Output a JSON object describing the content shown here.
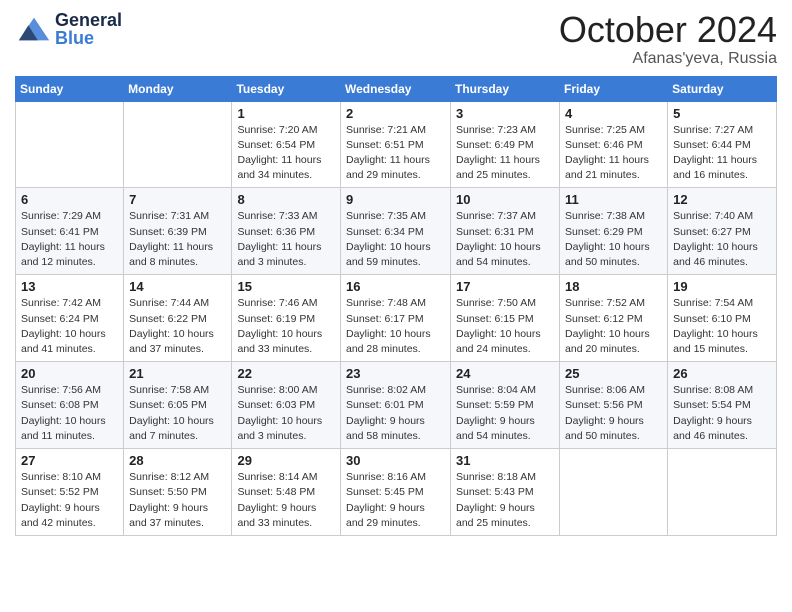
{
  "header": {
    "logo_general": "General",
    "logo_blue": "Blue",
    "month": "October 2024",
    "location": "Afanas'yeva, Russia"
  },
  "weekdays": [
    "Sunday",
    "Monday",
    "Tuesday",
    "Wednesday",
    "Thursday",
    "Friday",
    "Saturday"
  ],
  "weeks": [
    [
      {
        "day": "",
        "sunrise": "",
        "sunset": "",
        "daylight": ""
      },
      {
        "day": "",
        "sunrise": "",
        "sunset": "",
        "daylight": ""
      },
      {
        "day": "1",
        "sunrise": "Sunrise: 7:20 AM",
        "sunset": "Sunset: 6:54 PM",
        "daylight": "Daylight: 11 hours and 34 minutes."
      },
      {
        "day": "2",
        "sunrise": "Sunrise: 7:21 AM",
        "sunset": "Sunset: 6:51 PM",
        "daylight": "Daylight: 11 hours and 29 minutes."
      },
      {
        "day": "3",
        "sunrise": "Sunrise: 7:23 AM",
        "sunset": "Sunset: 6:49 PM",
        "daylight": "Daylight: 11 hours and 25 minutes."
      },
      {
        "day": "4",
        "sunrise": "Sunrise: 7:25 AM",
        "sunset": "Sunset: 6:46 PM",
        "daylight": "Daylight: 11 hours and 21 minutes."
      },
      {
        "day": "5",
        "sunrise": "Sunrise: 7:27 AM",
        "sunset": "Sunset: 6:44 PM",
        "daylight": "Daylight: 11 hours and 16 minutes."
      }
    ],
    [
      {
        "day": "6",
        "sunrise": "Sunrise: 7:29 AM",
        "sunset": "Sunset: 6:41 PM",
        "daylight": "Daylight: 11 hours and 12 minutes."
      },
      {
        "day": "7",
        "sunrise": "Sunrise: 7:31 AM",
        "sunset": "Sunset: 6:39 PM",
        "daylight": "Daylight: 11 hours and 8 minutes."
      },
      {
        "day": "8",
        "sunrise": "Sunrise: 7:33 AM",
        "sunset": "Sunset: 6:36 PM",
        "daylight": "Daylight: 11 hours and 3 minutes."
      },
      {
        "day": "9",
        "sunrise": "Sunrise: 7:35 AM",
        "sunset": "Sunset: 6:34 PM",
        "daylight": "Daylight: 10 hours and 59 minutes."
      },
      {
        "day": "10",
        "sunrise": "Sunrise: 7:37 AM",
        "sunset": "Sunset: 6:31 PM",
        "daylight": "Daylight: 10 hours and 54 minutes."
      },
      {
        "day": "11",
        "sunrise": "Sunrise: 7:38 AM",
        "sunset": "Sunset: 6:29 PM",
        "daylight": "Daylight: 10 hours and 50 minutes."
      },
      {
        "day": "12",
        "sunrise": "Sunrise: 7:40 AM",
        "sunset": "Sunset: 6:27 PM",
        "daylight": "Daylight: 10 hours and 46 minutes."
      }
    ],
    [
      {
        "day": "13",
        "sunrise": "Sunrise: 7:42 AM",
        "sunset": "Sunset: 6:24 PM",
        "daylight": "Daylight: 10 hours and 41 minutes."
      },
      {
        "day": "14",
        "sunrise": "Sunrise: 7:44 AM",
        "sunset": "Sunset: 6:22 PM",
        "daylight": "Daylight: 10 hours and 37 minutes."
      },
      {
        "day": "15",
        "sunrise": "Sunrise: 7:46 AM",
        "sunset": "Sunset: 6:19 PM",
        "daylight": "Daylight: 10 hours and 33 minutes."
      },
      {
        "day": "16",
        "sunrise": "Sunrise: 7:48 AM",
        "sunset": "Sunset: 6:17 PM",
        "daylight": "Daylight: 10 hours and 28 minutes."
      },
      {
        "day": "17",
        "sunrise": "Sunrise: 7:50 AM",
        "sunset": "Sunset: 6:15 PM",
        "daylight": "Daylight: 10 hours and 24 minutes."
      },
      {
        "day": "18",
        "sunrise": "Sunrise: 7:52 AM",
        "sunset": "Sunset: 6:12 PM",
        "daylight": "Daylight: 10 hours and 20 minutes."
      },
      {
        "day": "19",
        "sunrise": "Sunrise: 7:54 AM",
        "sunset": "Sunset: 6:10 PM",
        "daylight": "Daylight: 10 hours and 15 minutes."
      }
    ],
    [
      {
        "day": "20",
        "sunrise": "Sunrise: 7:56 AM",
        "sunset": "Sunset: 6:08 PM",
        "daylight": "Daylight: 10 hours and 11 minutes."
      },
      {
        "day": "21",
        "sunrise": "Sunrise: 7:58 AM",
        "sunset": "Sunset: 6:05 PM",
        "daylight": "Daylight: 10 hours and 7 minutes."
      },
      {
        "day": "22",
        "sunrise": "Sunrise: 8:00 AM",
        "sunset": "Sunset: 6:03 PM",
        "daylight": "Daylight: 10 hours and 3 minutes."
      },
      {
        "day": "23",
        "sunrise": "Sunrise: 8:02 AM",
        "sunset": "Sunset: 6:01 PM",
        "daylight": "Daylight: 9 hours and 58 minutes."
      },
      {
        "day": "24",
        "sunrise": "Sunrise: 8:04 AM",
        "sunset": "Sunset: 5:59 PM",
        "daylight": "Daylight: 9 hours and 54 minutes."
      },
      {
        "day": "25",
        "sunrise": "Sunrise: 8:06 AM",
        "sunset": "Sunset: 5:56 PM",
        "daylight": "Daylight: 9 hours and 50 minutes."
      },
      {
        "day": "26",
        "sunrise": "Sunrise: 8:08 AM",
        "sunset": "Sunset: 5:54 PM",
        "daylight": "Daylight: 9 hours and 46 minutes."
      }
    ],
    [
      {
        "day": "27",
        "sunrise": "Sunrise: 8:10 AM",
        "sunset": "Sunset: 5:52 PM",
        "daylight": "Daylight: 9 hours and 42 minutes."
      },
      {
        "day": "28",
        "sunrise": "Sunrise: 8:12 AM",
        "sunset": "Sunset: 5:50 PM",
        "daylight": "Daylight: 9 hours and 37 minutes."
      },
      {
        "day": "29",
        "sunrise": "Sunrise: 8:14 AM",
        "sunset": "Sunset: 5:48 PM",
        "daylight": "Daylight: 9 hours and 33 minutes."
      },
      {
        "day": "30",
        "sunrise": "Sunrise: 8:16 AM",
        "sunset": "Sunset: 5:45 PM",
        "daylight": "Daylight: 9 hours and 29 minutes."
      },
      {
        "day": "31",
        "sunrise": "Sunrise: 8:18 AM",
        "sunset": "Sunset: 5:43 PM",
        "daylight": "Daylight: 9 hours and 25 minutes."
      },
      {
        "day": "",
        "sunrise": "",
        "sunset": "",
        "daylight": ""
      },
      {
        "day": "",
        "sunrise": "",
        "sunset": "",
        "daylight": ""
      }
    ]
  ]
}
